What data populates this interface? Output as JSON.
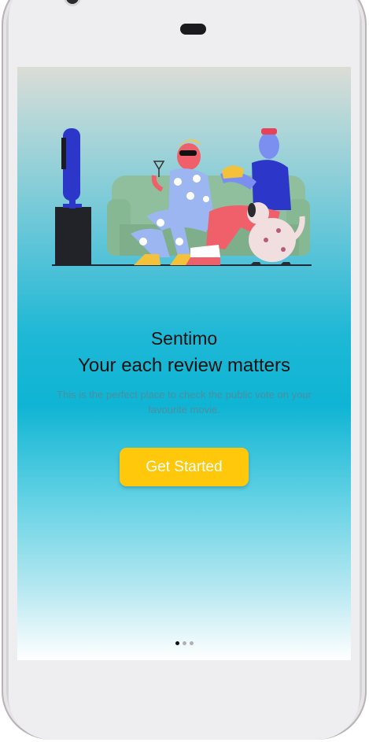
{
  "onboarding": {
    "app_name": "Sentimo",
    "tagline": "Your each review matters",
    "description": "This is the perfect place to check the public vote on your favourite movie.",
    "cta_label": "Get Started",
    "page_indicator": {
      "current": 1,
      "total": 3
    }
  },
  "colors": {
    "accent_button": "#ffc80a",
    "background_top": "#dcdcd6",
    "background_mid": "#0fb4d4",
    "background_bottom": "#ffffff"
  },
  "icons": [
    "front-camera-icon",
    "earpiece-icon",
    "proximity-sensor-icon",
    "tv-watching-illustration"
  ]
}
